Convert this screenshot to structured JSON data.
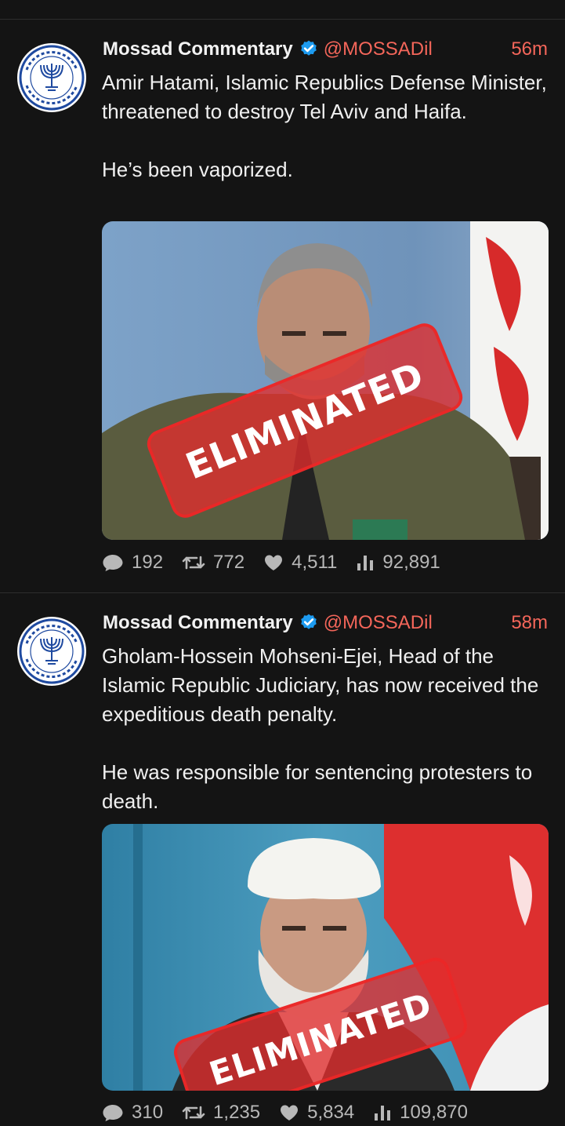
{
  "tweets": [
    {
      "author": "Mossad Commentary",
      "handle": "@MOSSADil",
      "time": "56m",
      "text": "Amir Hatami, Islamic Republics Defense Minister, threatened to destroy Tel Aviv and Haifa.\n\nHe’s been vaporized.",
      "stamp": "ELIMINATED",
      "stats": {
        "replies": "192",
        "retweets": "772",
        "likes": "4,511",
        "views": "92,891"
      }
    },
    {
      "author": "Mossad Commentary",
      "handle": "@MOSSADil",
      "time": "58m",
      "text": "Gholam-Hossein Mohseni-Ejei, Head of the Islamic Republic Judiciary, has now received the expeditious death penalty.\n\nHe was responsible for sentencing protesters to death.",
      "stamp": "ELIMINATED",
      "stats": {
        "replies": "310",
        "retweets": "1,235",
        "likes": "5,834",
        "views": "109,870"
      }
    }
  ],
  "colors": {
    "background": "#141414",
    "accent": "#f4665a",
    "verified": "#1d9bf0",
    "stamp": "#e12d2d",
    "logo": "#1f4aa0"
  },
  "icons": [
    "verified-badge-icon",
    "reply-icon",
    "retweet-icon",
    "like-icon",
    "views-icon",
    "mossad-emblem-icon"
  ]
}
